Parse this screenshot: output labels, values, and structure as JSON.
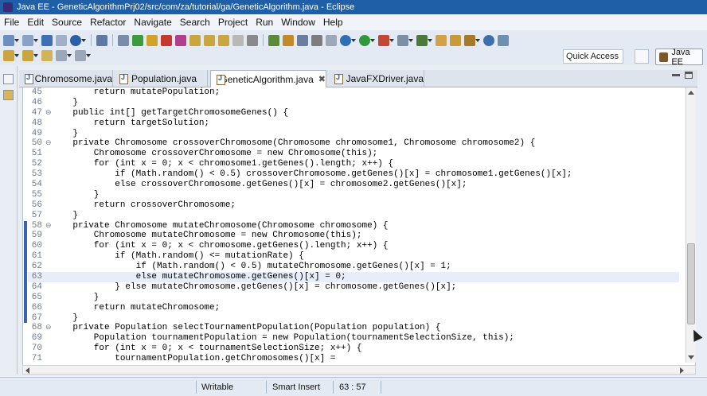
{
  "window": {
    "title": "Java EE - GeneticAlgorithmPrj02/src/com/za/tutorial/ga/GeneticAlgorithm.java - Eclipse"
  },
  "menu": [
    "File",
    "Edit",
    "Source",
    "Refactor",
    "Navigate",
    "Search",
    "Project",
    "Run",
    "Window",
    "Help"
  ],
  "toolbar": {
    "quick_access_placeholder": "Quick Access",
    "perspective_label": "Java EE"
  },
  "tabs": [
    {
      "label": "Chromosome.java",
      "active": false
    },
    {
      "label": "Population.java",
      "active": false
    },
    {
      "label": "GeneticAlgorithm.java",
      "active": true,
      "close": "✖"
    },
    {
      "label": "JavaFXDriver.java",
      "active": false
    }
  ],
  "editor": {
    "lines": [
      {
        "num": "45",
        "fold": "",
        "code": "        return mutatePopulation;"
      },
      {
        "num": "46",
        "fold": "",
        "code": "    }"
      },
      {
        "num": "47",
        "fold": "⊖",
        "code": "    public int[] getTargetChromosomeGenes() {"
      },
      {
        "num": "48",
        "fold": "",
        "code": "        return targetSolution;"
      },
      {
        "num": "49",
        "fold": "",
        "code": "    }"
      },
      {
        "num": "50",
        "fold": "⊖",
        "code": "    private Chromosome crossoverChromosome(Chromosome chromosome1, Chromosome chromosome2) {"
      },
      {
        "num": "51",
        "fold": "",
        "code": "        Chromosome crossoverChromosome = new Chromosome(this);"
      },
      {
        "num": "52",
        "fold": "",
        "code": "        for (int x = 0; x < chromosome1.getGenes().length; x++) {"
      },
      {
        "num": "53",
        "fold": "",
        "code": "            if (Math.random() < 0.5) crossoverChromosome.getGenes()[x] = chromosome1.getGenes()[x];"
      },
      {
        "num": "54",
        "fold": "",
        "code": "            else crossoverChromosome.getGenes()[x] = chromosome2.getGenes()[x];"
      },
      {
        "num": "55",
        "fold": "",
        "code": "        }"
      },
      {
        "num": "56",
        "fold": "",
        "code": "        return crossoverChromosome;"
      },
      {
        "num": "57",
        "fold": "",
        "code": "    }"
      },
      {
        "num": "58",
        "fold": "⊖",
        "code": "    private Chromosome mutateChromosome(Chromosome chromosome) {"
      },
      {
        "num": "59",
        "fold": "",
        "code": "        Chromosome mutateChromosome = new Chromosome(this);"
      },
      {
        "num": "60",
        "fold": "",
        "code": "        for (int x = 0; x < chromosome.getGenes().length; x++) {"
      },
      {
        "num": "61",
        "fold": "",
        "code": "            if (Math.random() <= mutationRate) {"
      },
      {
        "num": "62",
        "fold": "",
        "code": "                if (Math.random() < 0.5) mutateChromosome.getGenes()[x] = 1;"
      },
      {
        "num": "63",
        "fold": "",
        "code": "                else mutateChromosome.getGenes()[x] = 0;"
      },
      {
        "num": "64",
        "fold": "",
        "code": "            } else mutateChromosome.getGenes()[x] = chromosome.getGenes()[x];"
      },
      {
        "num": "65",
        "fold": "",
        "code": "        }"
      },
      {
        "num": "66",
        "fold": "",
        "code": "        return mutateChromosome;"
      },
      {
        "num": "67",
        "fold": "",
        "code": "    }"
      },
      {
        "num": "68",
        "fold": "⊖",
        "code": "    private Population selectTournamentPopulation(Population population) {"
      },
      {
        "num": "69",
        "fold": "",
        "code": "        Population tournamentPopulation = new Population(tournamentSelectionSize, this);"
      },
      {
        "num": "70",
        "fold": "",
        "code": "        for (int x = 0; x < tournamentSelectionSize; x++) {"
      },
      {
        "num": "71",
        "fold": "",
        "code": "            tournamentPopulation.getChromosomes()[x] ="
      }
    ],
    "current_line": "63"
  },
  "status": {
    "mode": "Writable",
    "insert": "Smart Insert",
    "position": "63 : 57"
  }
}
